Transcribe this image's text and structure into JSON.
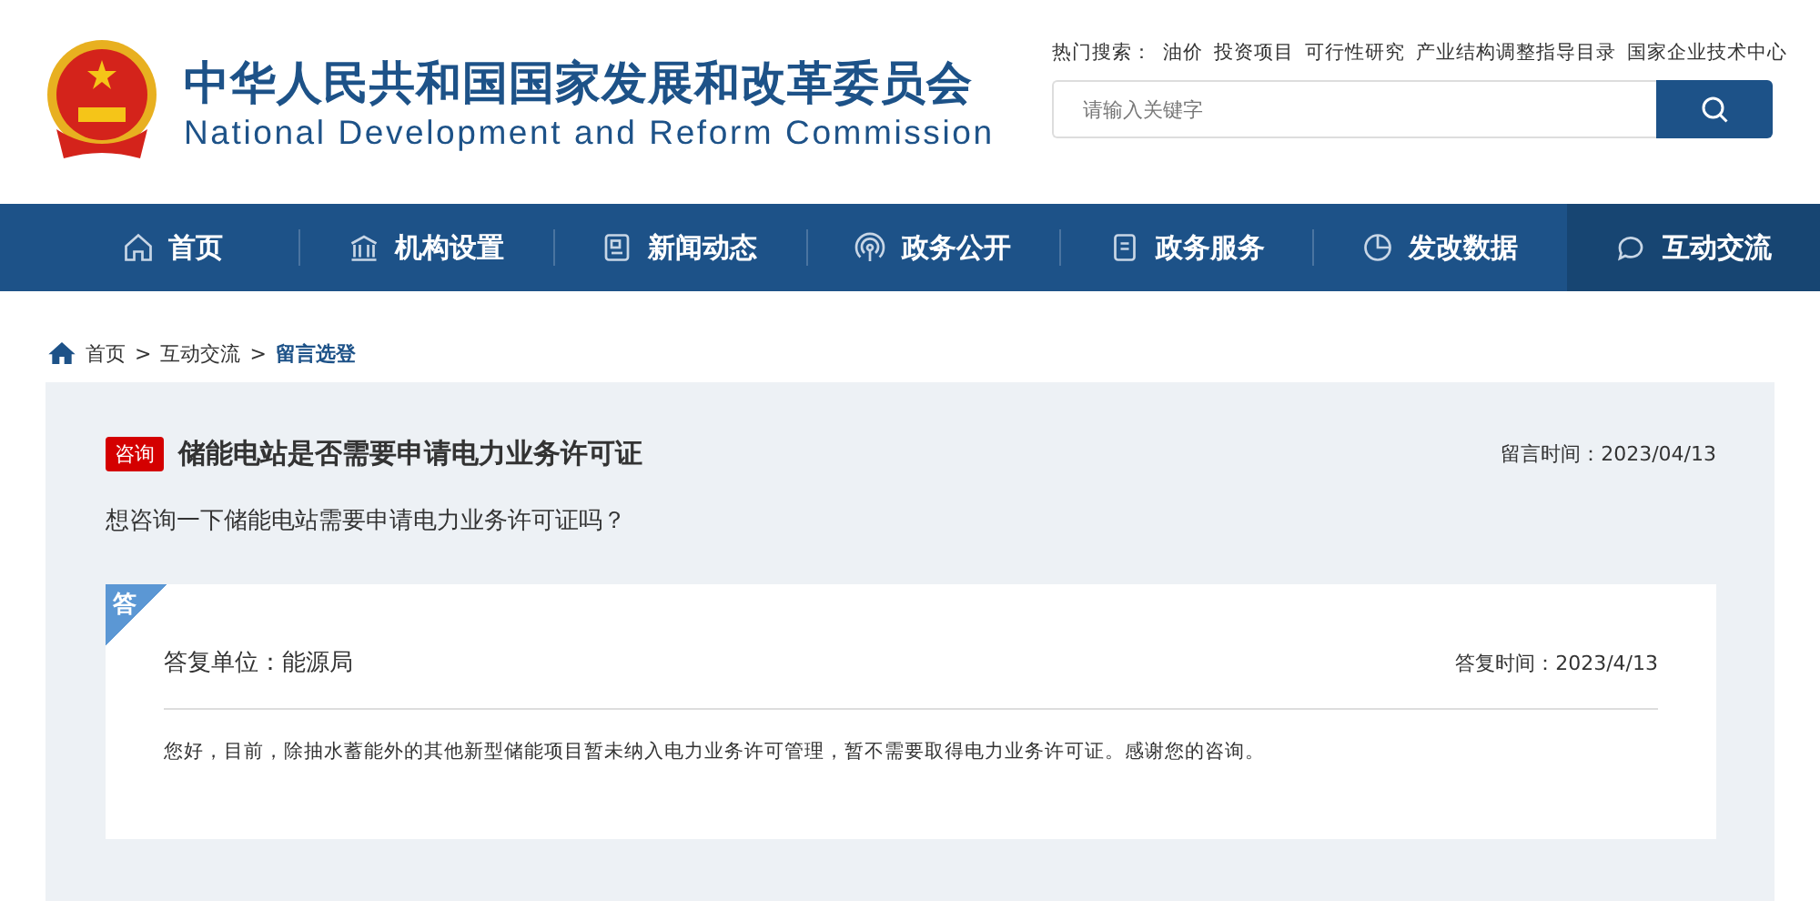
{
  "header": {
    "title": "中华人民共和国国家发展和改革委员会",
    "subtitle": "National Development and Reform Commission",
    "hot_search": {
      "label": "热门搜索：",
      "links": [
        "油价",
        "投资项目",
        "可行性研究",
        "产业结构调整指导目录",
        "国家企业技术中心"
      ]
    },
    "search": {
      "placeholder": "请输入关键字"
    }
  },
  "nav": [
    {
      "label": "首页",
      "kind": "home",
      "selected": false
    },
    {
      "label": "机构设置",
      "kind": "building",
      "selected": false
    },
    {
      "label": "新闻动态",
      "kind": "news",
      "selected": false
    },
    {
      "label": "政务公开",
      "kind": "signal",
      "selected": false
    },
    {
      "label": "政务服务",
      "kind": "doc",
      "selected": false
    },
    {
      "label": "发改数据",
      "kind": "pie",
      "selected": false
    },
    {
      "label": "互动交流",
      "kind": "chat",
      "selected": true
    }
  ],
  "breadcrumb": [
    {
      "label": "首页",
      "current": false
    },
    {
      "separator": ">",
      "label": "互动交流",
      "current": false
    },
    {
      "separator": ">",
      "label": "留言选登",
      "current": true
    }
  ],
  "message": {
    "tag": "咨询",
    "title": "储能电站是否需要申请电力业务许可证",
    "time": "留言时间：2023/04/13",
    "body": "想咨询一下储能电站需要申请电力业务许可证吗？"
  },
  "reply": {
    "badge": "答",
    "unit": "答复单位：能源局",
    "time": "答复时间：2023/4/13",
    "body": "您好，目前，除抽水蓄能外的其他新型储能项目暂未纳入电力业务许可管理，暂不需要取得电力业务许可证。感谢您的咨询。"
  }
}
